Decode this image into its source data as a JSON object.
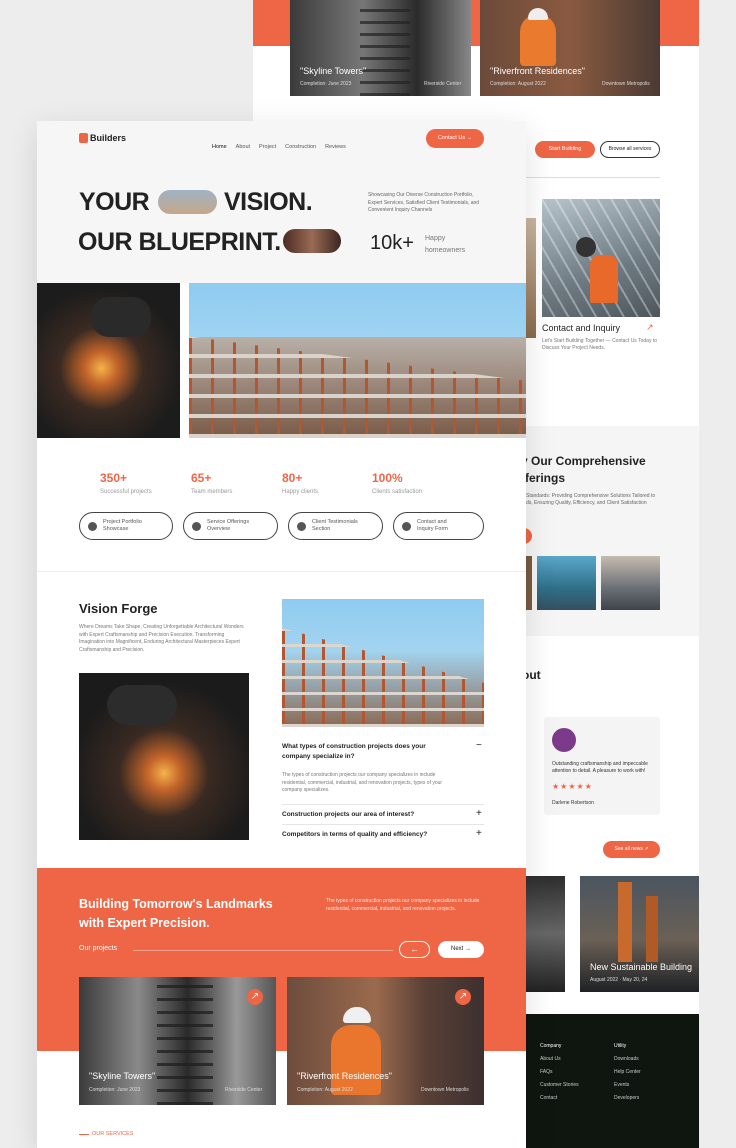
{
  "back_top": {
    "tiles": [
      {
        "title": "\"Skyline Towers\"",
        "date": "Completion: June 2023",
        "loc": "Riverside Center"
      },
      {
        "title": "\"Riverfront Residences\"",
        "date": "Completion: August 2022",
        "loc": "Downtown Metropolis"
      }
    ]
  },
  "back_mid": {
    "start_btn": "Start Building",
    "browse_btn": "Browse all services",
    "contact_title": "Contact and Inquiry",
    "contact_desc": "Let's Start Building Together — Contact Us Today to Discuss Your Project Needs."
  },
  "back_services": {
    "title": "y Our Comprehensive",
    "title2": "fferings",
    "desc": "Standards: Providing Comprehensive Solutions Tailored to ds, Ensuring Quality, Efficiency, and Client Satisfaction"
  },
  "back_testimonial": {
    "heading": "out",
    "quote": "Outstanding craftsmanship and impeccable attention to detail. A pleasure to work with!",
    "stars": "★★★★★",
    "name": "Darlene Robertson",
    "see_all": "See all news"
  },
  "back_news": {
    "title": "New Sustainable Building",
    "date": "August 2022 · May 20, 24"
  },
  "back_footer": {
    "col1_title": "Company",
    "col1": [
      "About Us",
      "FAQs",
      "Customer Stories",
      "Contact"
    ],
    "col2_title": "Utility",
    "col2": [
      "Downloads",
      "Help Center",
      "Events",
      "Developers"
    ]
  },
  "header": {
    "logo": "Builders",
    "nav": [
      "Home",
      "About",
      "Project",
      "Construction",
      "Reviews"
    ],
    "contact_btn": "Contact Us"
  },
  "hero": {
    "line1a": "YOUR",
    "line1b": "VISION.",
    "line2": "OUR BLUEPRINT.",
    "desc": "Showcasing Our Diverse Construction Portfolio, Expert Services, Satisfied Client Testimonials, and Convenient Inquiry Channels",
    "metric": "10k+",
    "metric_label": "Happy homeowners"
  },
  "stats": [
    {
      "n": "350+",
      "l": "Successful projects"
    },
    {
      "n": "65+",
      "l": "Team members"
    },
    {
      "n": "80+",
      "l": "Happy clients"
    },
    {
      "n": "100%",
      "l": "Clients satisfaction"
    }
  ],
  "pills": [
    [
      "Project Portfolio",
      "Showcase"
    ],
    [
      "Service Offerings",
      "Overview"
    ],
    [
      "Client Testimonials",
      "Section"
    ],
    [
      "Contact and",
      "Inquiry Form"
    ]
  ],
  "vision": {
    "title": "Vision Forge",
    "desc": "Where Dreams Take Shape, Creating Unforgettable Architectural Wonders with Expert Craftsmanship and Precision Execution. Transforming Imagination into Magnificent, Enduring Architectural Masterpieces Expert Craftsmanship and Precision."
  },
  "faq": [
    {
      "q": "What types of construction projects does your company specialize in?",
      "a": "The types of construction projects our company specializes in include residential, commercial, industrial, and renovation projects, types of your company specializes.",
      "icon": "−"
    },
    {
      "q": "Construction projects our area of interest?",
      "icon": "+"
    },
    {
      "q": "Competitors in terms of quality and efficiency?",
      "icon": "+"
    }
  ],
  "orange": {
    "title1": "Building Tomorrow's Landmarks",
    "title2": "with Expert Precision.",
    "desc": "The types of construction projects our company specializes in include residential, commercial, industrial, and renovation projects.",
    "label": "Our projects",
    "prev": "←",
    "next": "Next"
  },
  "projects": [
    {
      "title": "\"Skyline Towers\"",
      "date": "Completion: June 2023",
      "loc": "Riverside Center"
    },
    {
      "title": "\"Riverfront Residences\"",
      "date": "Completion: August 2022",
      "loc": "Downtown Metropolis"
    }
  ],
  "services_label": "OUR SERVICES",
  "colors": {
    "accent": "#ef6646",
    "dark": "#0f150f"
  }
}
